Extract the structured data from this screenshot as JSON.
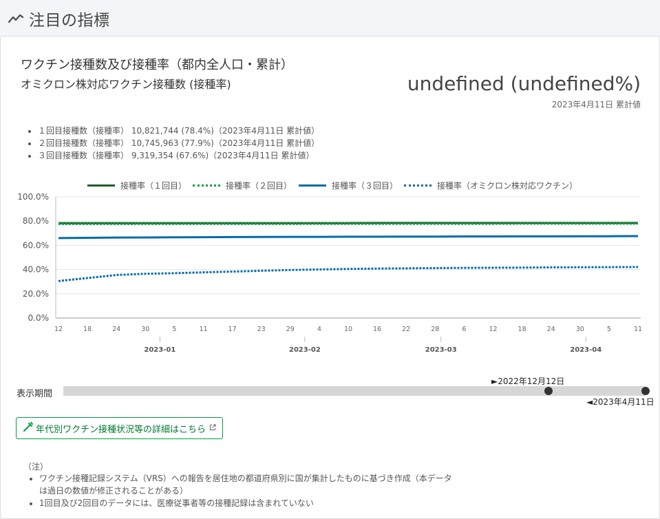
{
  "header": {
    "title": "注目の指標",
    "icon": "trend-icon"
  },
  "card": {
    "title": "ワクチン接種数及び接種率（都内全人口・累計）",
    "subtitle": "オミクロン株対応ワクチン接種数 (接種率)",
    "big_value": "undefined (undefined%)",
    "big_caption": "2023年4月11日 累計値",
    "stats": [
      "１回目接種数（接種率） 10,821,744 (78.4%)（2023年4月11日 累計値）",
      "２回目接種数（接種率） 10,745,963 (77.9%)（2023年4月11日 累計値）",
      "３回目接種数（接種率） 9,319,354 (67.6%)（2023年4月11日 累計値）"
    ]
  },
  "chart_data": {
    "type": "line",
    "x": [
      "2022-12-12",
      "2022-12-18",
      "2022-12-24",
      "2022-12-30",
      "2023-01-05",
      "2023-01-11",
      "2023-01-17",
      "2023-01-23",
      "2023-01-29",
      "2023-02-04",
      "2023-02-10",
      "2023-02-16",
      "2023-02-22",
      "2023-02-28",
      "2023-03-06",
      "2023-03-12",
      "2023-03-18",
      "2023-03-24",
      "2023-03-30",
      "2023-04-05",
      "2023-04-11"
    ],
    "x_tick_labels": [
      "12",
      "18",
      "24",
      "30",
      "5",
      "11",
      "17",
      "23",
      "29",
      "4",
      "10",
      "16",
      "22",
      "28",
      "6",
      "12",
      "18",
      "24",
      "30",
      "5",
      "11"
    ],
    "month_labels": [
      {
        "label": "2023-01",
        "at_tick": 3.5
      },
      {
        "label": "2023-02",
        "at_tick": 8.5
      },
      {
        "label": "2023-03",
        "at_tick": 13.2
      },
      {
        "label": "2023-04",
        "at_tick": 18.2
      }
    ],
    "y_tick_labels": [
      "0.0%",
      "20.0%",
      "40.0%",
      "60.0%",
      "80.0%",
      "100.0%"
    ],
    "ylim": [
      0,
      100
    ],
    "grid": true,
    "legend_position": "top",
    "series": [
      {
        "name": "接種率（１回目）",
        "color": "#1e5c2c",
        "dash": "solid",
        "values": [
          78.3,
          78.3,
          78.3,
          78.3,
          78.3,
          78.3,
          78.3,
          78.3,
          78.3,
          78.3,
          78.3,
          78.4,
          78.4,
          78.4,
          78.4,
          78.4,
          78.4,
          78.4,
          78.4,
          78.4,
          78.4
        ]
      },
      {
        "name": "接種率（２回目）",
        "color": "#00a040",
        "dash": "dotted",
        "values": [
          77.6,
          77.6,
          77.6,
          77.7,
          77.7,
          77.7,
          77.7,
          77.7,
          77.7,
          77.8,
          77.8,
          77.8,
          77.8,
          77.8,
          77.8,
          77.8,
          77.9,
          77.9,
          77.9,
          77.9,
          77.9
        ]
      },
      {
        "name": "接種率（３回目）",
        "color": "#006ca8",
        "dash": "solid",
        "values": [
          66.0,
          66.2,
          66.4,
          66.5,
          66.6,
          66.7,
          66.8,
          66.9,
          67.0,
          67.0,
          67.1,
          67.1,
          67.2,
          67.2,
          67.3,
          67.3,
          67.4,
          67.4,
          67.5,
          67.5,
          67.6
        ]
      },
      {
        "name": "接種率（オミクロン株対応ワクチン）",
        "color": "#006ca8",
        "dash": "dotted",
        "values": [
          30.5,
          33.0,
          35.5,
          36.5,
          37.0,
          37.7,
          38.3,
          39.0,
          39.6,
          40.1,
          40.5,
          40.8,
          41.0,
          41.2,
          41.4,
          41.5,
          41.6,
          41.8,
          41.9,
          42.0,
          42.1
        ]
      }
    ]
  },
  "period": {
    "label": "表示期間",
    "start": "►2022年12月12日",
    "end": "◄2023年4月11日",
    "start_fraction": 0.8333,
    "end_fraction": 1.0
  },
  "link": {
    "label": "年代別ワクチン接種状況等の詳細はこちら"
  },
  "notes": {
    "title": "（注）",
    "items": [
      "ワクチン接種記録システム（VRS）への報告を居住地の都道府県別に国が集計したものに基づき作成（本データは過日の数値が修正されることがある）",
      "1回目及び2回目のデータには、医療従事者等の接種記録は含まれていない"
    ]
  }
}
